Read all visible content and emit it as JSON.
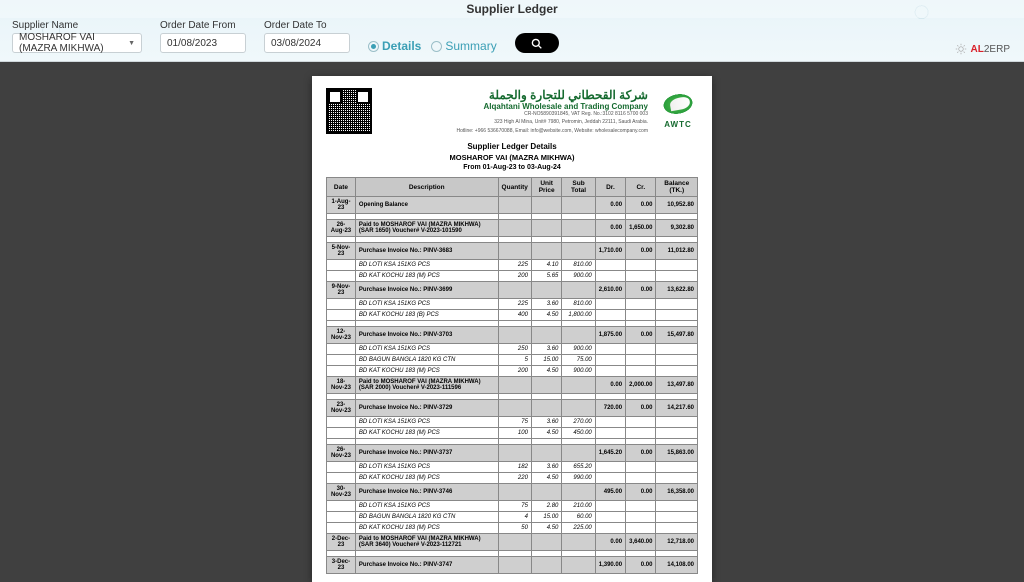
{
  "app": {
    "title": "Supplier Ledger"
  },
  "filters": {
    "supplier_label": "Supplier Name",
    "supplier_value": "MOSHAROF VAI (MAZRA MIKHWA)",
    "from_label": "Order Date From",
    "from_value": "01/08/2023",
    "to_label": "Order Date To",
    "to_value": "03/08/2024",
    "mode_details": "Details",
    "mode_summary": "Summary"
  },
  "brand": {
    "name1": "AL",
    "name2": "2ERP"
  },
  "company": {
    "arabic": "شركة القحطاني للتجارة والجملة",
    "english": "Alqahtani Wholesale and Trading Company",
    "reg": "CR-NO5890391845, VAT Reg. No.:3102 8116 5700 003",
    "addr1": "323 High Al Mina, Unit# 7980, Petromin, Jeddah 22111, Saudi Arabia.",
    "addr2": "Hotline: +966 536670088, Email: info@website.com, Website: wholesalecompany.com",
    "logo_text": "AWTC"
  },
  "doc": {
    "title": "Supplier Ledger Details",
    "supplier": "MOSHAROF VAI (MAZRA MIKHWA)",
    "range": "From 01-Aug-23 to 03-Aug-24"
  },
  "columns": [
    "Date",
    "Description",
    "Quantity",
    "Unit Price",
    "Sub Total",
    "Dr.",
    "Cr.",
    "Balance (TK.)"
  ],
  "rows": [
    {
      "t": "h",
      "date": "1-Aug-23",
      "desc": "Opening Balance",
      "dr": "0.00",
      "cr": "0.00",
      "bal": "10,952.80"
    },
    {
      "t": "s"
    },
    {
      "t": "h",
      "date": "26-Aug-23",
      "desc": "Paid to MOSHAROF VAI (MAZRA MIKHWA) (SAR 1650) Voucher# V-2023-101590",
      "dr": "0.00",
      "cr": "1,650.00",
      "bal": "9,302.80"
    },
    {
      "t": "s"
    },
    {
      "t": "h",
      "date": "5-Nov-23",
      "desc": "Purchase Invoice No.: PINV-3683",
      "dr": "1,710.00",
      "cr": "0.00",
      "bal": "11,012.80"
    },
    {
      "t": "i",
      "desc": "BD LOTI KSA 151KG PCS",
      "qty": "225",
      "up": "4.10",
      "st": "810.00"
    },
    {
      "t": "i",
      "desc": "BD KAT KOCHU 183 (M) PCS",
      "qty": "200",
      "up": "5.65",
      "st": "900.00"
    },
    {
      "t": "h",
      "date": "9-Nov-23",
      "desc": "Purchase Invoice No.: PINV-3699",
      "dr": "2,610.00",
      "cr": "0.00",
      "bal": "13,622.80"
    },
    {
      "t": "i",
      "desc": "BD LOTI KSA 151KG PCS",
      "qty": "225",
      "up": "3.60",
      "st": "810.00"
    },
    {
      "t": "i",
      "desc": "BD KAT KOCHU 183 (B) PCS",
      "qty": "400",
      "up": "4.50",
      "st": "1,800.00"
    },
    {
      "t": "s"
    },
    {
      "t": "h",
      "date": "12-Nov-23",
      "desc": "Purchase Invoice No.: PINV-3703",
      "dr": "1,875.00",
      "cr": "0.00",
      "bal": "15,497.80"
    },
    {
      "t": "i",
      "desc": "BD LOTI KSA 151KG PCS",
      "qty": "250",
      "up": "3.60",
      "st": "900.00"
    },
    {
      "t": "i",
      "desc": "BD BAGUN BANGLA 1820 KG CTN",
      "qty": "5",
      "up": "15.00",
      "st": "75.00"
    },
    {
      "t": "i",
      "desc": "BD KAT KOCHU 183 (M) PCS",
      "qty": "200",
      "up": "4.50",
      "st": "900.00"
    },
    {
      "t": "h",
      "date": "18-Nov-23",
      "desc": "Paid to MOSHAROF VAI (MAZRA MIKHWA) (SAR 2000) Voucher# V-2023-111596",
      "dr": "0.00",
      "cr": "2,000.00",
      "bal": "13,497.80"
    },
    {
      "t": "s"
    },
    {
      "t": "h",
      "date": "23-Nov-23",
      "desc": "Purchase Invoice No.: PINV-3729",
      "dr": "720.00",
      "cr": "0.00",
      "bal": "14,217.60"
    },
    {
      "t": "i",
      "desc": "BD LOTI KSA 151KG PCS",
      "qty": "75",
      "up": "3.60",
      "st": "270.00"
    },
    {
      "t": "i",
      "desc": "BD KAT KOCHU 183 (M) PCS",
      "qty": "100",
      "up": "4.50",
      "st": "450.00"
    },
    {
      "t": "s"
    },
    {
      "t": "h",
      "date": "26-Nov-23",
      "desc": "Purchase Invoice No.: PINV-3737",
      "dr": "1,645.20",
      "cr": "0.00",
      "bal": "15,863.00"
    },
    {
      "t": "i",
      "desc": "BD LOTI KSA 151KG PCS",
      "qty": "182",
      "up": "3.60",
      "st": "655.20"
    },
    {
      "t": "i",
      "desc": "BD KAT KOCHU 183 (M) PCS",
      "qty": "220",
      "up": "4.50",
      "st": "990.00"
    },
    {
      "t": "h",
      "date": "30-Nov-23",
      "desc": "Purchase Invoice No.: PINV-3746",
      "dr": "495.00",
      "cr": "0.00",
      "bal": "16,358.00"
    },
    {
      "t": "i",
      "desc": "BD LOTI KSA 151KG PCS",
      "qty": "75",
      "up": "2.80",
      "st": "210.00"
    },
    {
      "t": "i",
      "desc": "BD BAGUN BANGLA 1820 KG CTN",
      "qty": "4",
      "up": "15.00",
      "st": "60.00"
    },
    {
      "t": "i",
      "desc": "BD KAT KOCHU 183 (M) PCS",
      "qty": "50",
      "up": "4.50",
      "st": "225.00"
    },
    {
      "t": "h",
      "date": "2-Dec-23",
      "desc": "Paid to MOSHAROF VAI (MAZRA MIKHWA) (SAR 3640)  Voucher# V-2023-112721",
      "dr": "0.00",
      "cr": "3,640.00",
      "bal": "12,718.00"
    },
    {
      "t": "s"
    },
    {
      "t": "h",
      "date": "3-Dec-23",
      "desc": "Purchase Invoice No.: PINV-3747",
      "dr": "1,390.00",
      "cr": "0.00",
      "bal": "14,108.00"
    }
  ]
}
